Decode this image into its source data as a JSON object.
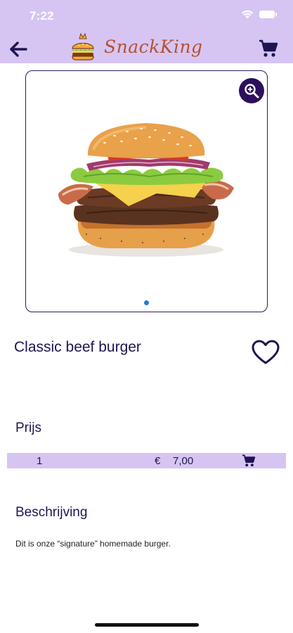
{
  "status_bar": {
    "time": "7:22",
    "wifi_icon": "wifi-icon",
    "battery_icon": "battery-icon"
  },
  "app_bar": {
    "back_icon": "arrow-left-icon",
    "logo_icon": "burger-crown-logo",
    "title": "SnackKing",
    "cart_icon": "cart-icon",
    "background_color": "#d6c5f3"
  },
  "product": {
    "image": "classic-beef-burger-photo",
    "zoom_icon": "zoom-in-icon",
    "page_count": 1,
    "active_page": 1,
    "name": "Classic beef burger",
    "favorite_icon": "heart-outline-icon"
  },
  "price_section": {
    "heading": "Prijs",
    "quantity": "1",
    "currency": "€",
    "amount": "7,00",
    "add_to_cart_icon": "cart-icon"
  },
  "description_section": {
    "heading": "Beschrijving",
    "text": "Dit is onze “signature” homemade burger."
  },
  "colors": {
    "accent": "#d6c5f3",
    "primary_text": "#1f1452",
    "zoom_button": "#2d0f5c",
    "logo_text": "#b5512f",
    "pager_dot": "#1e7fd6"
  }
}
